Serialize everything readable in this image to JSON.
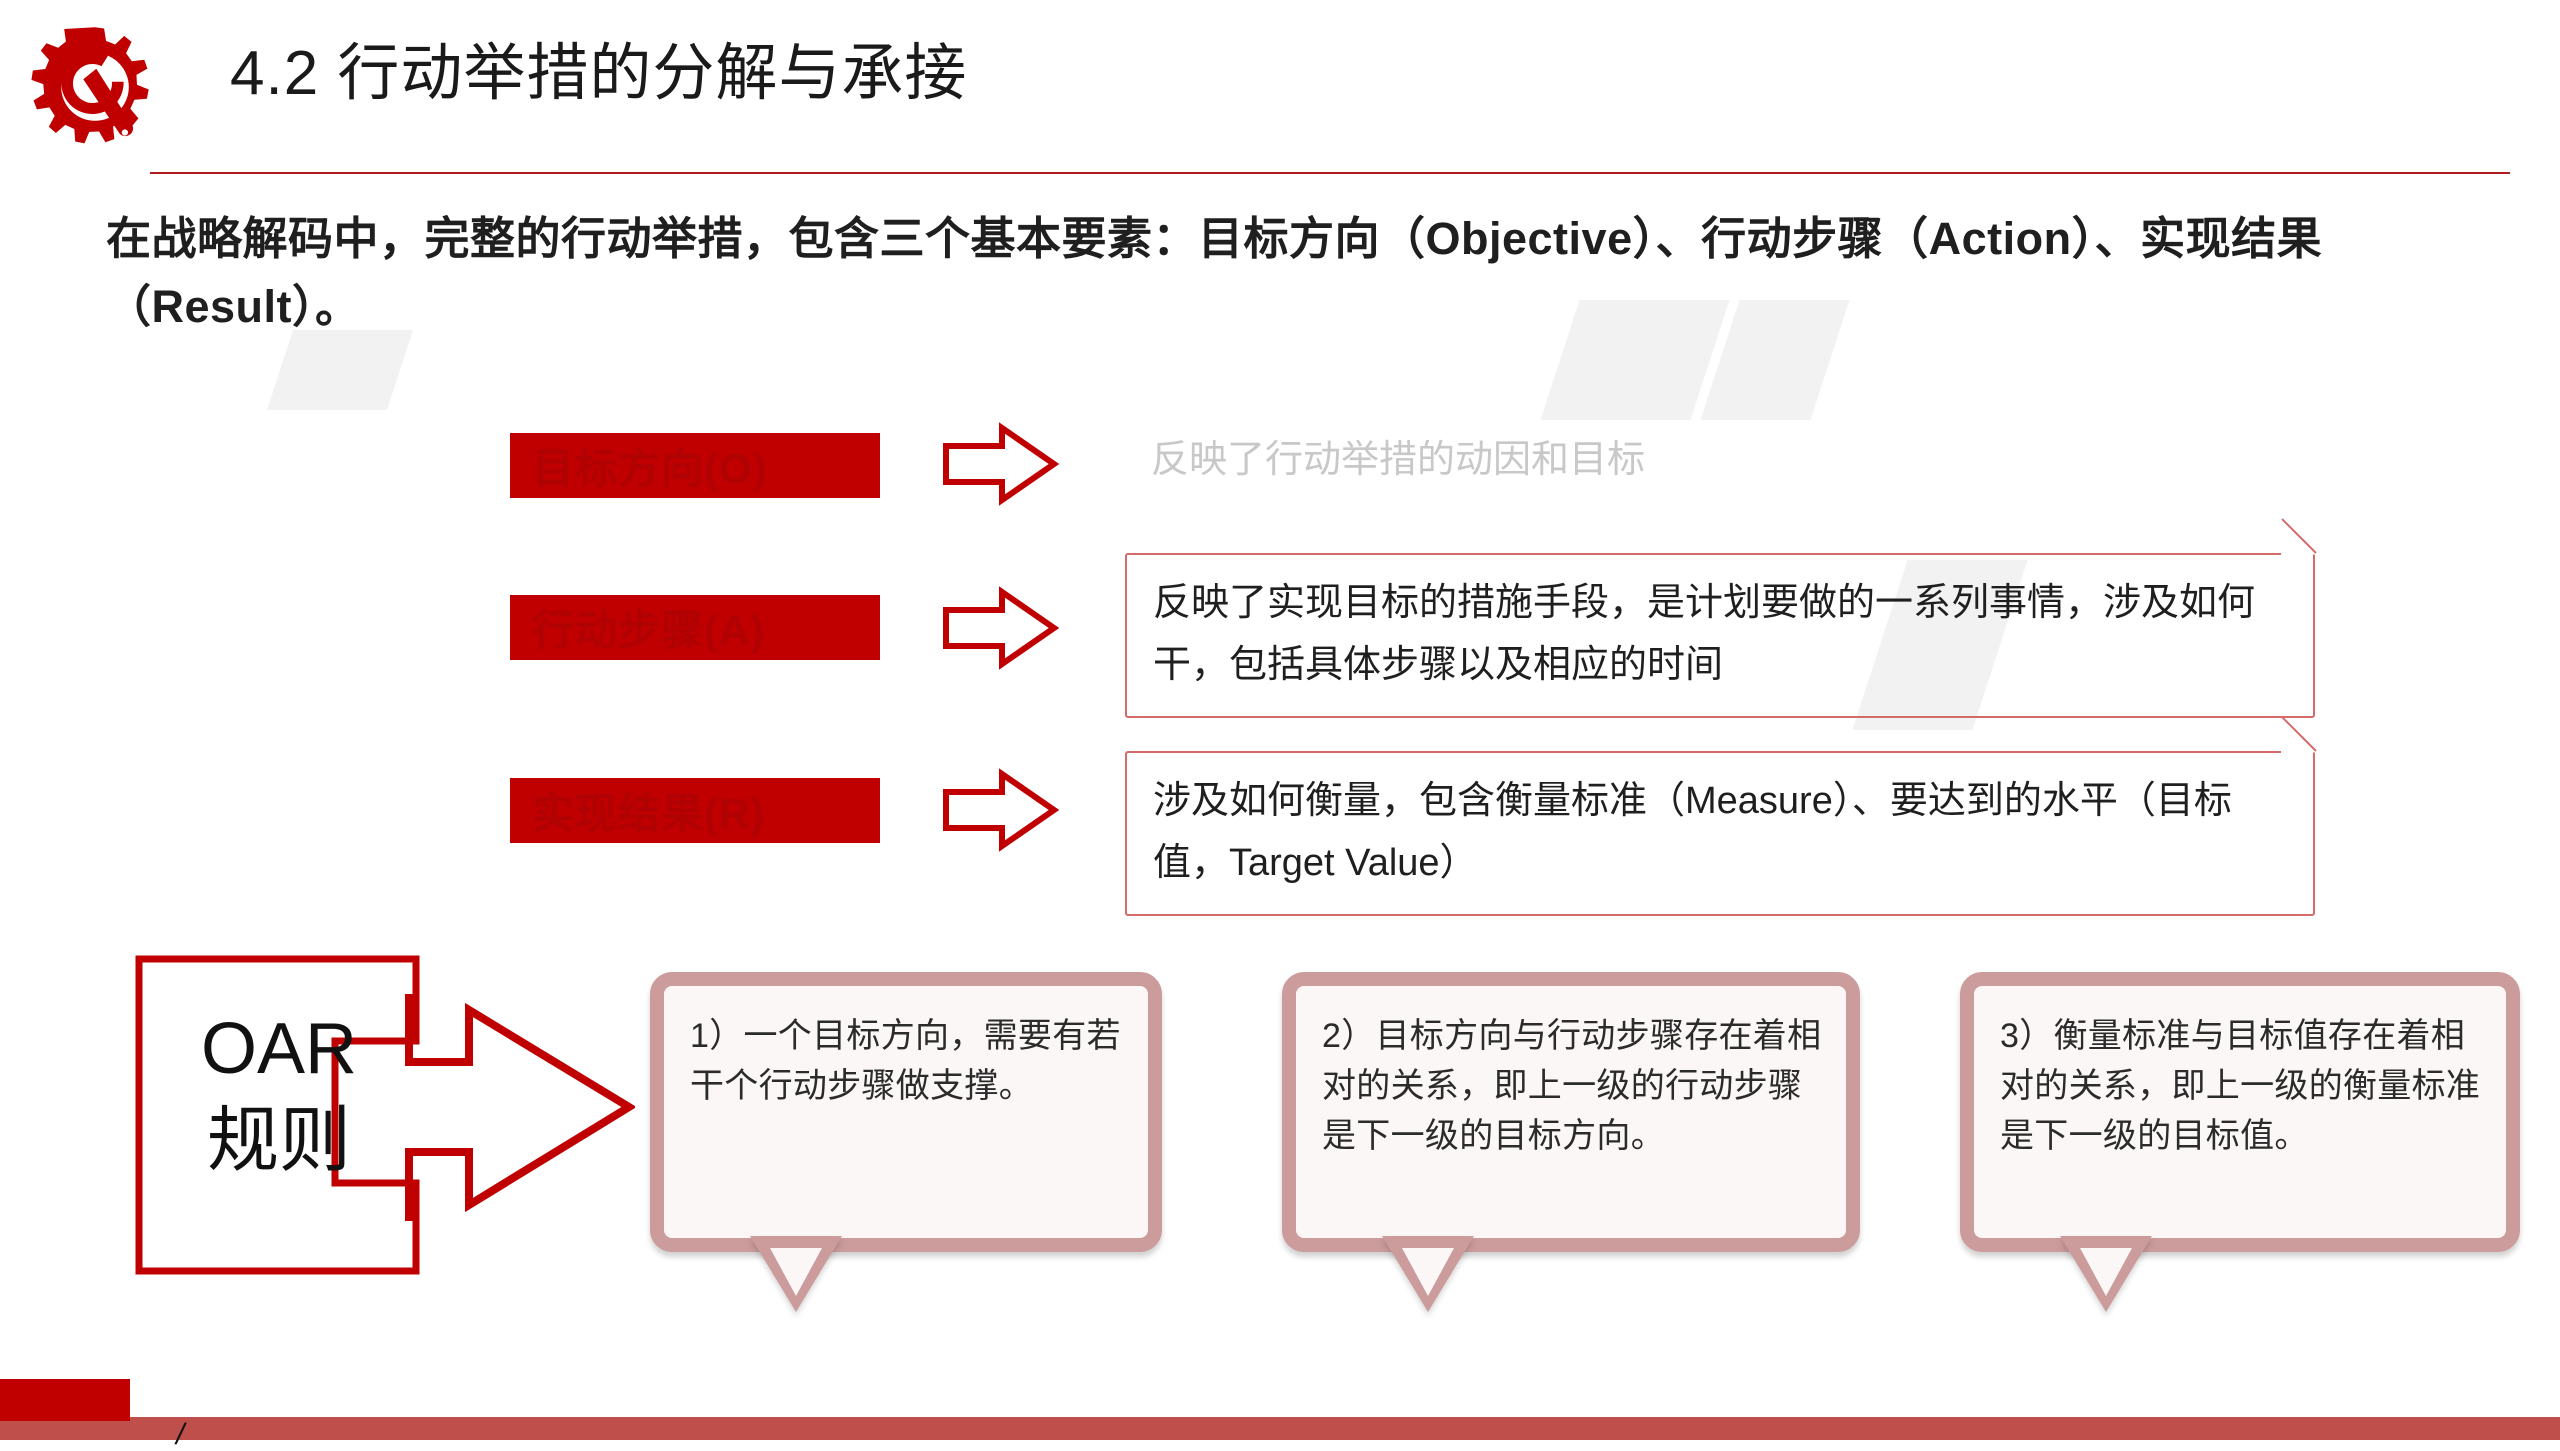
{
  "header": {
    "icon": "gear-wrench-icon",
    "title": "4.2 行动举措的分解与承接",
    "rule_color": "#b01a1a"
  },
  "intro": {
    "text": "在战略解码中，完整的行动举措，包含三个基本要素：目标方向（Objective）、行动步骤（Action）、实现结果（Result）。"
  },
  "elements": [
    {
      "tag": "目标方向(O)",
      "arrow": "right-arrow-icon",
      "description": "反映了行动举措的动因和目标",
      "boxed": false
    },
    {
      "tag": "行动步骤(A)",
      "arrow": "right-arrow-icon",
      "description": "反映了实现目标的措施手段，是计划要做的一系列事情，涉及如何干，包括具体步骤以及相应的时间",
      "boxed": true
    },
    {
      "tag": "实现结果(R)",
      "arrow": "right-arrow-icon",
      "description": "涉及如何衡量，包含衡量标准（Measure）、要达到的水平（目标值，Target Value）",
      "boxed": true
    }
  ],
  "oar": {
    "line1": "OAR",
    "line2": "规则",
    "arrow": "right-arrow-icon",
    "border_color": "#c00000"
  },
  "callouts": [
    {
      "text": "1）一个目标方向，需要有若干个行动步骤做支撑。"
    },
    {
      "text": "2）目标方向与行动步骤存在着相对的关系，即上一级的行动步骤是下一级的目标方向。"
    },
    {
      "text": "3）衡量标准与目标值存在着相对的关系，即上一级的衡量标准是下一级的目标值。"
    }
  ],
  "footer": {
    "slash": "/",
    "block_color": "#c00000",
    "bar_color": "#bf4f4a"
  },
  "theme": {
    "accent_red": "#c00000",
    "muted_red": "#d46a6a",
    "bubble_border": "#cc9c9c",
    "bubble_fill": "#fbf7f6",
    "ghost_text": "#c8c8c8"
  }
}
